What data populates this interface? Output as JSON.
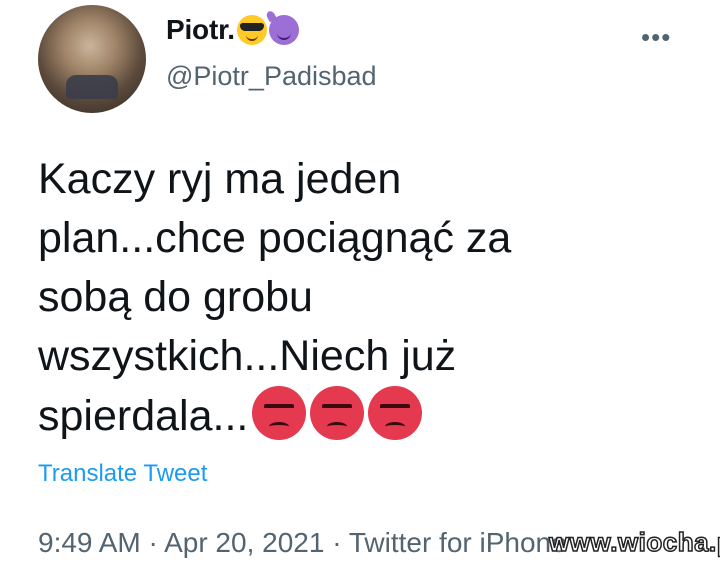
{
  "author": {
    "display_name": "Piotr.",
    "emojis": [
      "smiling-face-with-sunglasses",
      "smiling-face-with-horns"
    ],
    "handle": "@Piotr_Padisbad"
  },
  "menu": {
    "more_label": "•••"
  },
  "tweet": {
    "lines": [
      "Kaczy ryj ma jeden",
      "plan...chce pociągnąć za",
      "sobą do grobu",
      "wszystkich...Niech już",
      "spierdala..."
    ],
    "trailing_emojis": [
      "pouting-face",
      "pouting-face",
      "pouting-face"
    ]
  },
  "translate_label": "Translate Tweet",
  "meta": {
    "time": "9:49 AM",
    "separator": "·",
    "date": "Apr 20, 2021",
    "source": "Twitter for iPhone"
  },
  "watermark": "www.wiocha.pl",
  "colors": {
    "link": "#1d9bf0",
    "secondary": "#536471",
    "text": "#0f1419"
  }
}
